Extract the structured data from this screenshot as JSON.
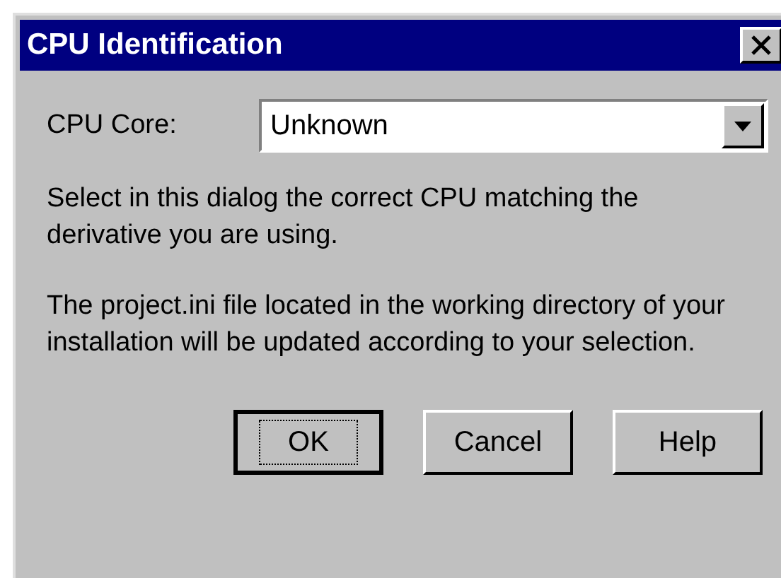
{
  "window": {
    "title": "CPU Identification"
  },
  "cpu_core": {
    "label": "CPU Core:",
    "value": "Unknown"
  },
  "paragraphs": [
    "Select in this dialog the correct CPU matching the derivative you are using.",
    "The project.ini file located in the working directory of your installation will be updated according to your selection."
  ],
  "buttons": [
    {
      "label": "OK",
      "focused": true
    },
    {
      "label": "Cancel",
      "focused": false
    },
    {
      "label": "Help",
      "focused": false
    }
  ]
}
